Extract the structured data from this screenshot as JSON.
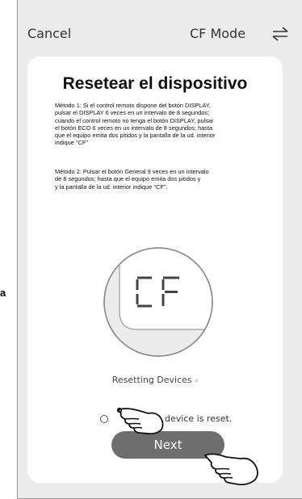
{
  "outside": {
    "margin_letter": "a"
  },
  "header": {
    "cancel_label": "Cancel",
    "mode_label": "CF Mode",
    "switch_icon": "swap-arrows-icon"
  },
  "card": {
    "title": "Resetear el dispositivo",
    "method1_lines": [
      "Método 1: Si el control remoto dispone del botón DISPLAY,",
      "pulsar el DISPLAY 6 veces en un intervalo de 8 segundos;",
      "cuando el control remoto no tenga el botón DISPLAY, pulsar",
      "el botón ECO  6 veces en un intervalo de 8 segundos; hasta",
      "que el equipo emita dos pitidos y la pantalla de la ud. interior",
      "indique \"CF\""
    ],
    "method2_lines": [
      "Método 2: Pulsar el botón General 9 veces en un intervalo",
      "de 8 segundos; hasta que el equipo emita dos pitidos y",
      "y la pantalla de la ud. interior indique \"CF\"."
    ],
    "display_code": "CF",
    "resetting_label": "Resetting Devices",
    "confirm_text": "n the device is reset.",
    "next_label": "Next"
  },
  "colors": {
    "phone_bg": "#ececec",
    "card_bg": "#ffffff",
    "button_bg": "#6e6e6e",
    "text": "#333333"
  }
}
